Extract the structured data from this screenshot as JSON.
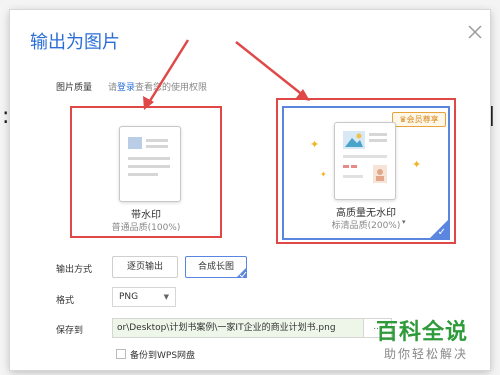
{
  "dialog": {
    "title": "输出为图片"
  },
  "quality": {
    "label": "图片质量",
    "hint_prefix": "请",
    "hint_link": "登录",
    "hint_suffix": "查看您的使用权限"
  },
  "options": [
    {
      "title": "带水印",
      "subtitle": "普通品质(100%)"
    },
    {
      "title": "高质量无水印",
      "subtitle": "标清品质(200%)",
      "badge": "会员尊享"
    }
  ],
  "output_mode": {
    "label": "输出方式",
    "buttons": [
      "逐页输出",
      "合成长图"
    ],
    "selected": "合成长图"
  },
  "format": {
    "label": "格式",
    "value": "PNG"
  },
  "save_to": {
    "label": "保存到",
    "path": "or\\Desktop\\计划书案例\\一家IT企业的商业计划书.png",
    "browse_label": "..."
  },
  "backup": {
    "label": "备份到WPS网盘",
    "checked": false
  },
  "watermark": {
    "line1": "百科全说",
    "line2": "助你轻松解决"
  },
  "colors": {
    "accent": "#2b6fd6",
    "highlight": "#e04848",
    "badge": "#d9891c"
  }
}
